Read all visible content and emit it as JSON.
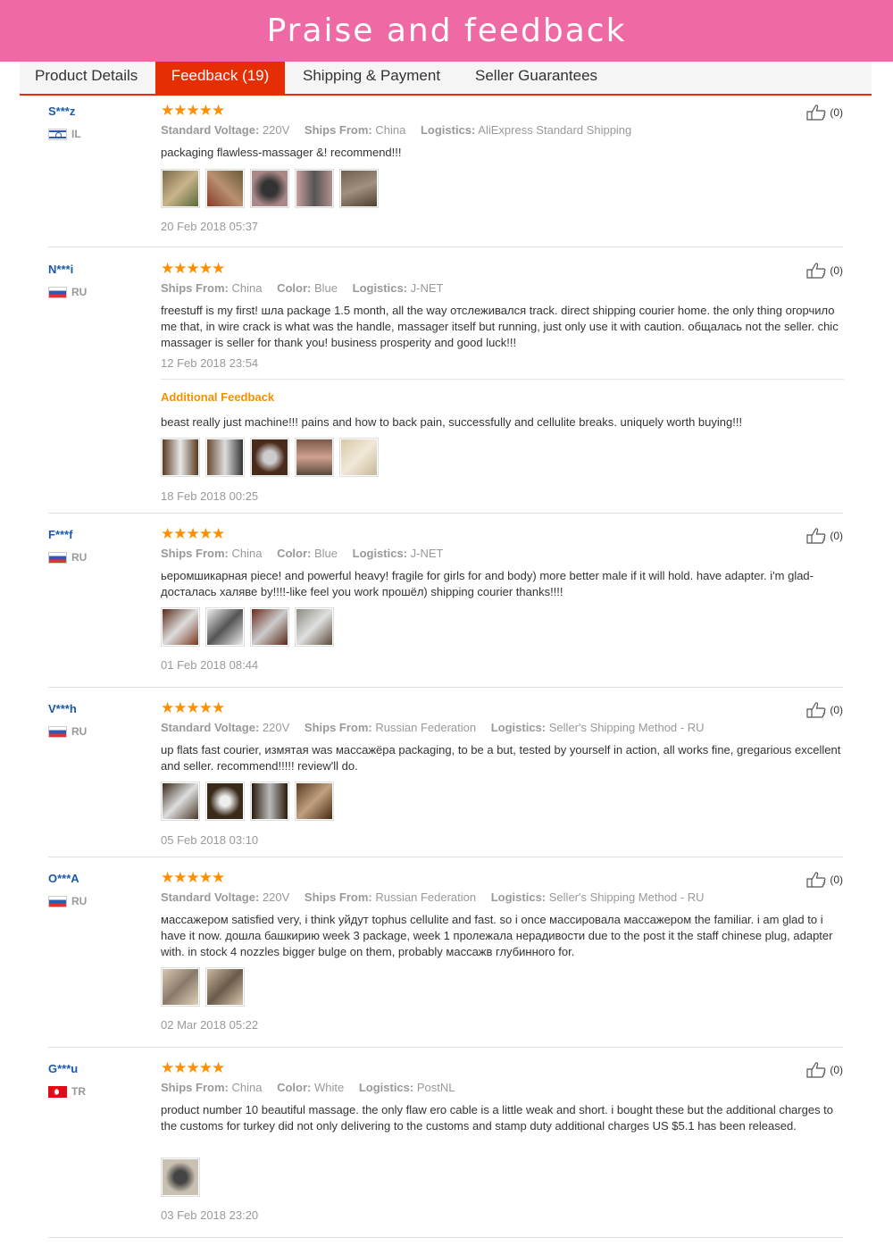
{
  "banner": {
    "title": "Praise and feedback"
  },
  "tabs": [
    {
      "label": "Product Details",
      "active": false
    },
    {
      "label": "Feedback (19)",
      "active": true
    },
    {
      "label": "Shipping & Payment",
      "active": false
    },
    {
      "label": "Seller Guarantees",
      "active": false
    }
  ],
  "reviews": [
    {
      "user": "S***z",
      "country": "IL",
      "flag": "il-flag-icon",
      "stars": "★★★★★",
      "attrs": [
        {
          "k": "Standard Voltage:",
          "v": "220V"
        },
        {
          "k": "Ships From:",
          "v": "China"
        },
        {
          "k": "Logistics:",
          "v": "AliExpress Standard Shipping"
        }
      ],
      "text": "packaging flawless-massager &! recommend!!!",
      "photos": 5,
      "date": "20 Feb 2018 05:37",
      "helpful": "(0)"
    },
    {
      "user": "N***i",
      "country": "RU",
      "flag": "ru-flag-icon",
      "stars": "★★★★★",
      "attrs": [
        {
          "k": "Ships From:",
          "v": "China"
        },
        {
          "k": "Color:",
          "v": "Blue"
        },
        {
          "k": "Logistics:",
          "v": "J-NET"
        }
      ],
      "text": "freestuff is my first! шла package 1.5 month, all the way отслеживался track. direct shipping courier home. the only thing огорчило me that, in wire crack is what was the handle, massager itself but running, just only use it with caution. общалась not the seller. chic massager is seller for thank you! business prosperity and good luck!!!",
      "photos": 0,
      "date": "12 Feb 2018 23:54",
      "helpful": "(0)",
      "additional": {
        "title": "Additional Feedback",
        "text": "beast really just machine!!! pains and how to back pain, successfully and cellulite breaks. uniquely worth buying!!!",
        "photos": 5,
        "date": "18 Feb 2018 00:25"
      }
    },
    {
      "user": "F***f",
      "country": "RU",
      "flag": "ru-flag-icon",
      "stars": "★★★★★",
      "attrs": [
        {
          "k": "Ships From:",
          "v": "China"
        },
        {
          "k": "Color:",
          "v": "Blue"
        },
        {
          "k": "Logistics:",
          "v": "J-NET"
        }
      ],
      "text": "ьеромшикарная piece! and powerful heavy! fragile for girls for and body) more better male if it will hold. have adapter. i'm glad-досталась халяве by!!!!-like feel you work прошёл) shipping courier thanks!!!!",
      "photos": 4,
      "date": "01 Feb 2018 08:44",
      "helpful": "(0)"
    },
    {
      "user": "V***h",
      "country": "RU",
      "flag": "ru-flag-icon",
      "stars": "★★★★★",
      "attrs": [
        {
          "k": "Standard Voltage:",
          "v": "220V"
        },
        {
          "k": "Ships From:",
          "v": "Russian Federation"
        },
        {
          "k": "Logistics:",
          "v": "Seller's Shipping Method - RU"
        }
      ],
      "text": "up flats fast courier, измятая was массажёра packaging, to be a but, tested by yourself in action, all works fine, gregarious excellent and seller. recommend!!!!! review'll do.",
      "photos": 4,
      "date": "05 Feb 2018 03:10",
      "helpful": "(0)"
    },
    {
      "user": "O***A",
      "country": "RU",
      "flag": "ru-flag-icon",
      "stars": "★★★★★",
      "attrs": [
        {
          "k": "Standard Voltage:",
          "v": "220V"
        },
        {
          "k": "Ships From:",
          "v": "Russian Federation"
        },
        {
          "k": "Logistics:",
          "v": "Seller's Shipping Method - RU"
        }
      ],
      "text": "массажером satisfied very, i think уйдут tophus cellulite and fast. so i once массировала массажером the familiar. i am glad to i have it now. дошла башкирию week 3 package, week 1 пролежала нерадивости due to the post it the staff chinese plug, adapter with. in stock 4 nozzles bigger bulge on them, probably массажв глубинного for.",
      "photos": 2,
      "date": "02 Mar 2018 05:22",
      "helpful": "(0)"
    },
    {
      "user": "G***u",
      "country": "TR",
      "flag": "tr-flag-icon",
      "stars": "★★★★★",
      "attrs": [
        {
          "k": "Ships From:",
          "v": "China"
        },
        {
          "k": "Color:",
          "v": "White"
        },
        {
          "k": "Logistics:",
          "v": "PostNL"
        }
      ],
      "text": "product number 10 beautiful massage. the only flaw ero cable is a little weak and short. i bought these but the additional charges to the customs for turkey did not only delivering to the customs and stamp duty additional charges US $5.1 has been released.",
      "photos": 1,
      "date": "03 Feb 2018 23:20",
      "helpful": "(0)"
    }
  ],
  "colors": {
    "banner": "#ef6aa5",
    "accent": "#e62e04",
    "user": "#1a5aa8",
    "star": "#ff8f00",
    "additional": "#f29100"
  }
}
